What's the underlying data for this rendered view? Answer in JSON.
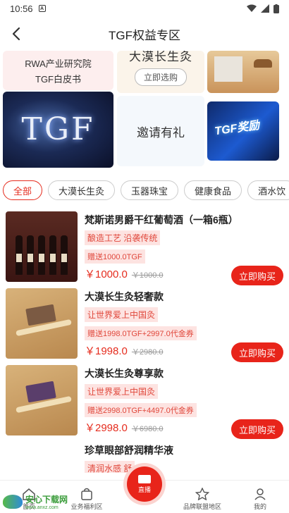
{
  "status_bar": {
    "time": "10:56"
  },
  "header": {
    "title": "TGF权益专区"
  },
  "banner": {
    "whitepaper_lines": [
      "RWA产业研究院",
      "TGF白皮书"
    ],
    "tgf_logo_text": "TGF",
    "ginseng_promo_title": "大漠长生灸",
    "ginseng_promo_button": "立即选购",
    "invite_text": "邀请有礼",
    "tgf_award_text": "TGF奖励"
  },
  "tabs": [
    "全部",
    "大漠长生灸",
    "玉器珠宝",
    "健康食品",
    "酒水饮"
  ],
  "active_tab": "全部",
  "products": [
    {
      "name": "梵斯诺男爵干红葡萄酒（一箱6瓶）",
      "tagline": "酿造工艺  沿袭传统",
      "gift": "赠送1000.0TGF",
      "price": "￥1000.0",
      "original_price": "￥1000.0",
      "button": "立即购买",
      "image": "wine"
    },
    {
      "name": "大漠长生灸轻奢款",
      "tagline": "让世界爱上中国灸",
      "gift": "赠送1998.0TGF+2997.0代金券",
      "price": "￥1998.0",
      "original_price": "￥2980.0",
      "button": "立即购买",
      "image": "ginseng"
    },
    {
      "name": "大漠长生灸尊享款",
      "tagline": "让世界爱上中国灸",
      "gift": "赠送2998.0TGF+4497.0代金券",
      "price": "￥2998.0",
      "original_price": "￥6980.0",
      "button": "立即购买",
      "image": "ginseng"
    },
    {
      "name": "珍草眼部舒润精华液",
      "tagline": "清润水感  舒"
    }
  ],
  "tab_bar": {
    "items": [
      "首页",
      "业务福利区",
      "直播",
      "品牌联盟地区",
      "我的"
    ],
    "live_label": "直播"
  },
  "watermark": {
    "line1": "安心下载网",
    "line2": "www.anxz.com"
  },
  "colors": {
    "accent": "#e8241a",
    "tag_bg": "#fde3e1",
    "tag_text": "#e0473b"
  }
}
